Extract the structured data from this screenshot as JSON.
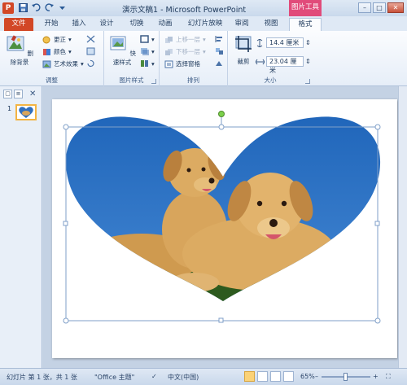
{
  "app": {
    "logo_letter": "P",
    "title": "演示文稿1 - Microsoft PowerPoint",
    "context_tab_header": "图片工具"
  },
  "quick_access": [
    "save-icon",
    "undo-icon",
    "redo-icon",
    "customize-icon"
  ],
  "window_controls": {
    "minimize": "–",
    "maximize": "□",
    "close": "✕"
  },
  "tabs": [
    {
      "label": "文件"
    },
    {
      "label": "开始"
    },
    {
      "label": "插入"
    },
    {
      "label": "设计"
    },
    {
      "label": "切换"
    },
    {
      "label": "动画"
    },
    {
      "label": "幻灯片放映"
    },
    {
      "label": "审阅"
    },
    {
      "label": "视图"
    },
    {
      "label": "格式"
    }
  ],
  "ribbon": {
    "adjust": {
      "remove_bg": "删除背景",
      "corrections": "更正",
      "color": "颜色",
      "artistic": "艺术效果",
      "label": "调整"
    },
    "picture_styles": {
      "quick_styles": "快速样式",
      "label": "图片样式"
    },
    "arrange": {
      "bring_forward": "上移一层",
      "send_backward": "下移一层",
      "selection_pane": "选择窗格",
      "label": "排列"
    },
    "size": {
      "crop": "裁剪",
      "height": "14.4 厘米",
      "width": "23.04 厘米",
      "label": "大小"
    }
  },
  "slides_pane": {
    "slide_number": "1"
  },
  "status": {
    "slide_info": "幻灯片 第 1 张，共 1 张",
    "theme": "\"Office 主题\"",
    "language": "中文(中国)",
    "zoom": "65%"
  },
  "colors": {
    "file_tab": "#d24726",
    "context_tab": "#e14b7a",
    "sky_top": "#1d63b8",
    "sky_bottom": "#4d90da",
    "dog_fur": "#d8a55c",
    "grass": "#2d5a1e"
  }
}
